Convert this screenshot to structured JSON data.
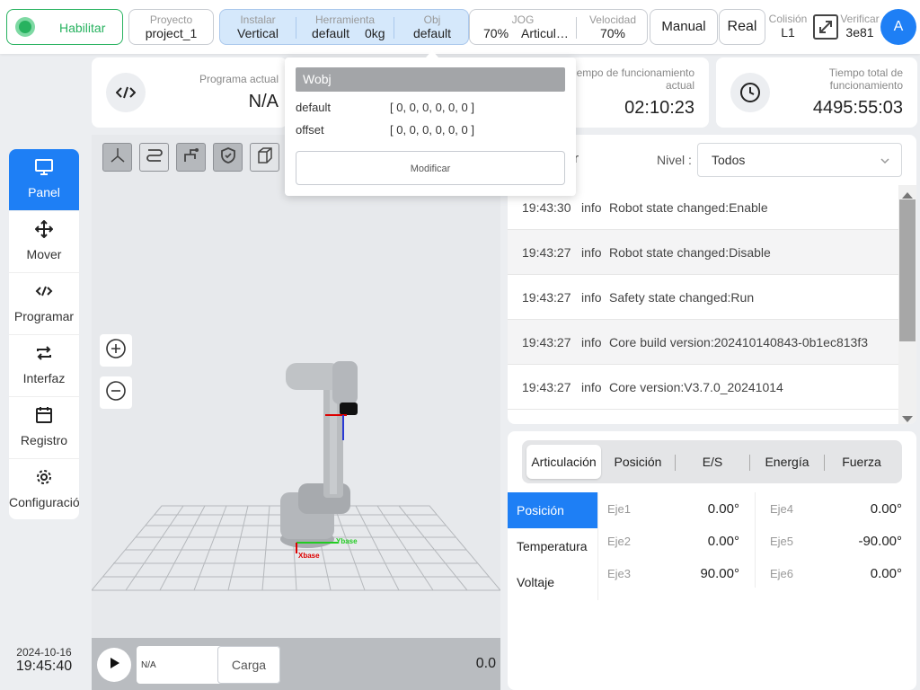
{
  "colors": {
    "accent": "#1e7ff5",
    "enable_green": "#27b25f",
    "selected_box": "#d5e8fb"
  },
  "topbar": {
    "enable_label": "Habilitar",
    "project": {
      "label": "Proyecto",
      "value": "project_1"
    },
    "install": {
      "label": "Instalar",
      "value": "Vertical"
    },
    "tool": {
      "label": "Herramienta",
      "value": "default",
      "load": "0kg"
    },
    "obj": {
      "label": "Obj",
      "value": "default"
    },
    "jog": {
      "label": "JOG",
      "value": "70%",
      "mode": "Articul…"
    },
    "speed": {
      "label": "Velocidad",
      "value": "70%"
    },
    "manual_label": "Manual",
    "real_label": "Real",
    "collision": {
      "label": "Colisión",
      "value": "L1"
    },
    "verify": {
      "label": "Verificar",
      "value": "3e81"
    },
    "avatar": "A"
  },
  "cards": {
    "program": {
      "label": "Programa actual",
      "value": "N/A"
    },
    "runtime": {
      "label": "Tiempo de funcionamiento actual",
      "label_visible": "empo de funcionamiento actual",
      "value": "02:10:23"
    },
    "total": {
      "label": "Tiempo total de funcionamiento",
      "value": "4495:55:03"
    }
  },
  "popover": {
    "title": "Wobj",
    "rows": [
      {
        "name": "default",
        "value": "[ 0, 0, 0, 0, 0, 0 ]"
      },
      {
        "name": "offset",
        "value": "[ 0, 0, 0, 0, 0, 0 ]"
      }
    ],
    "modify_label": "Modificar"
  },
  "sidebar": {
    "items": [
      {
        "label": "Panel",
        "icon": "monitor-icon"
      },
      {
        "label": "Mover",
        "icon": "move-icon"
      },
      {
        "label": "Programar",
        "icon": "code-icon"
      },
      {
        "label": "Interfaz",
        "icon": "swap-icon"
      },
      {
        "label": "Registro",
        "icon": "calendar-icon"
      },
      {
        "label": "Configuración",
        "icon": "gear-icon"
      }
    ]
  },
  "datetime": {
    "date": "2024-10-16",
    "time": "19:45:40"
  },
  "viewport": {
    "axis_x": "Xbase",
    "axis_y": "Ybase",
    "program_name": "N/A",
    "load_label": "Carga",
    "progress_value": "0.0"
  },
  "log": {
    "filter_fragment": "r",
    "level_label": "Nivel :",
    "level_value": "Todos",
    "rows": [
      {
        "time": "19:43:30",
        "level": "info",
        "msg": "Robot state changed:Enable"
      },
      {
        "time": "19:43:27",
        "level": "info",
        "msg": "Robot state changed:Disable"
      },
      {
        "time": "19:43:27",
        "level": "info",
        "msg": "Safety state changed:Run"
      },
      {
        "time": "19:43:27",
        "level": "info",
        "msg": "Core build version:202410140843-0b1ec813f3"
      },
      {
        "time": "19:43:27",
        "level": "info",
        "msg": "Core version:V3.7.0_20241014"
      }
    ]
  },
  "joints_panel": {
    "tabs": [
      "Articulación",
      "Posición",
      "E/S",
      "Energía",
      "Fuerza"
    ],
    "side_tabs": [
      "Posición",
      "Temperatura",
      "Voltaje"
    ],
    "joints": [
      {
        "name": "Eje1",
        "value": "0.00°"
      },
      {
        "name": "Eje2",
        "value": "0.00°"
      },
      {
        "name": "Eje3",
        "value": "90.00°"
      },
      {
        "name": "Eje4",
        "value": "0.00°"
      },
      {
        "name": "Eje5",
        "value": "-90.00°"
      },
      {
        "name": "Eje6",
        "value": "0.00°"
      }
    ]
  }
}
